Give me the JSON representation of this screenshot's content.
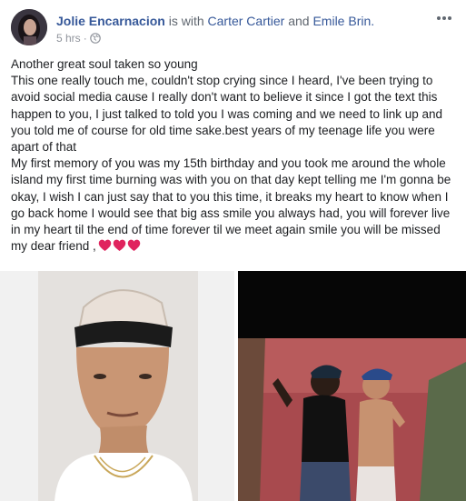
{
  "post": {
    "author": "Jolie Encarnacion",
    "with_text": "is with",
    "tagged": [
      "Carter Cartier",
      "Emile Brin."
    ],
    "and_text": "and",
    "time": "5 hrs",
    "privacy_icon": "globe-icon",
    "menu_icon": "more-icon",
    "paragraphs": [
      "Another great soul taken so young",
      "This one really touch me, couldn't stop crying since I heard, I've been trying to avoid social media cause I really don't want to believe it since I got the text this happen to you, I just talked to told you I was coming and we need to link up and you told me of course for old time sake.best years of my teenage life you were apart of that",
      "My first memory of you was my 15th birthday and you took me around the whole island my first time burning was with you on that day kept telling me I'm gonna be okay, I wish I can just say that to you this time, it breaks my heart to know when I go back home I would see that big ass smile you always had, you will forever live in my heart til the end of time forever til we meet again smile you will be missed my dear friend ,"
    ],
    "hearts": [
      "heart-icon",
      "heart-icon",
      "heart-icon"
    ],
    "colors": {
      "name_link": "#365899",
      "meta": "#90949c",
      "text": "#1c1e21",
      "heart": "#e0245e"
    }
  }
}
